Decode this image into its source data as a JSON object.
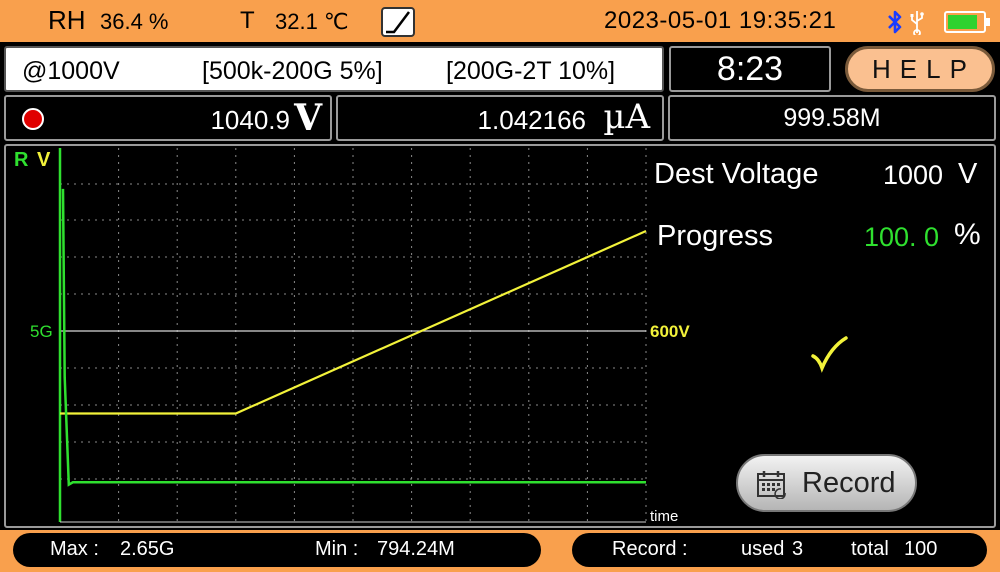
{
  "status_bar": {
    "rh_label": "RH",
    "rh_value": "36.4 %",
    "temp_label": "T",
    "temp_value": "32.1 ℃",
    "mode_icon": "ramp-icon",
    "datetime": "2023-05-01 19:35:21",
    "bluetooth_icon": "bluetooth-icon",
    "usb_icon": "usb-icon",
    "battery_level": 0.85,
    "battery_color": "#2fd22f"
  },
  "range": {
    "test_voltage": "@1000V",
    "range1": "[500k-200G  5%]",
    "range2": "[200G-2T  10%]"
  },
  "timer": "8:23",
  "help_label": "HELP",
  "measurements": {
    "voltage_value": "1040.9",
    "voltage_unit": "V",
    "current_value": "1.042166",
    "current_unit": "µA",
    "resistance": "999.58M",
    "status_color": "#e00000"
  },
  "chart_data": {
    "type": "line",
    "axis_labels": {
      "left_r": "R",
      "left_v": "V",
      "x": "time"
    },
    "markers": {
      "resistance_mark": "5G",
      "voltage_mark": "600V"
    },
    "grid": true,
    "colors": {
      "resistance": "#2fe02f",
      "voltage": "#f2f23a"
    },
    "series": [
      {
        "name": "V",
        "y_units": "V",
        "points": [
          [
            0,
            270
          ],
          [
            0.3,
            270
          ],
          [
            1.0,
            1000
          ]
        ]
      },
      {
        "name": "R",
        "y_units": "GΩ",
        "points": [
          [
            0,
            8.7
          ],
          [
            0.008,
            3.8
          ],
          [
            0.015,
            1.0
          ],
          [
            0.022,
            1.06
          ],
          [
            1.0,
            1.06
          ]
        ]
      }
    ]
  },
  "side_panel": {
    "dest_voltage_label": "Dest Voltage",
    "dest_voltage_value": "1000",
    "dest_voltage_unit": "V",
    "progress_label": "Progress",
    "progress_value": "100. 0",
    "progress_unit": "%",
    "progress_color": "#2fe02f",
    "record_button_label": "Record"
  },
  "bottom_bar": {
    "max_label": "Max :",
    "max_value": "2.65G",
    "min_label": "Min :",
    "min_value": "794.24M",
    "record_label": "Record  :",
    "used_label": "used",
    "used_value": "3",
    "total_label": "total",
    "total_value": "100"
  }
}
